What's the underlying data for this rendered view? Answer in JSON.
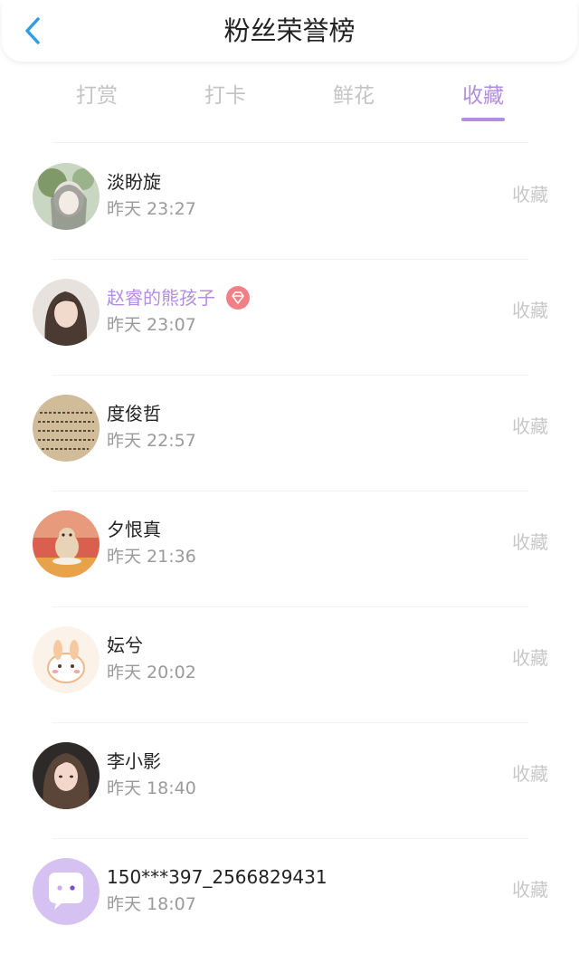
{
  "header": {
    "title": "粉丝荣誉榜"
  },
  "tabs": [
    {
      "label": "打赏",
      "active": false
    },
    {
      "label": "打卡",
      "active": false
    },
    {
      "label": "鲜花",
      "active": false
    },
    {
      "label": "收藏",
      "active": true
    }
  ],
  "colors": {
    "accent": "#b38de0",
    "back_arrow": "#2f9ce8",
    "badge": "#f07f86"
  },
  "fans": [
    {
      "name": "淡盼旋",
      "time": "昨天 23:27",
      "action": "收藏",
      "vip": false
    },
    {
      "name": "赵睿的熊孩子",
      "time": "昨天 23:07",
      "action": "收藏",
      "vip": true
    },
    {
      "name": "度俊哲",
      "time": "昨天 22:57",
      "action": "收藏",
      "vip": false
    },
    {
      "name": "夕恨真",
      "time": "昨天 21:36",
      "action": "收藏",
      "vip": false
    },
    {
      "name": "妘兮",
      "time": "昨天 20:02",
      "action": "收藏",
      "vip": false
    },
    {
      "name": "李小影",
      "time": "昨天 18:40",
      "action": "收藏",
      "vip": false
    },
    {
      "name": "150***397_2566829431",
      "time": "昨天 18:07",
      "action": "收藏",
      "vip": false
    }
  ]
}
